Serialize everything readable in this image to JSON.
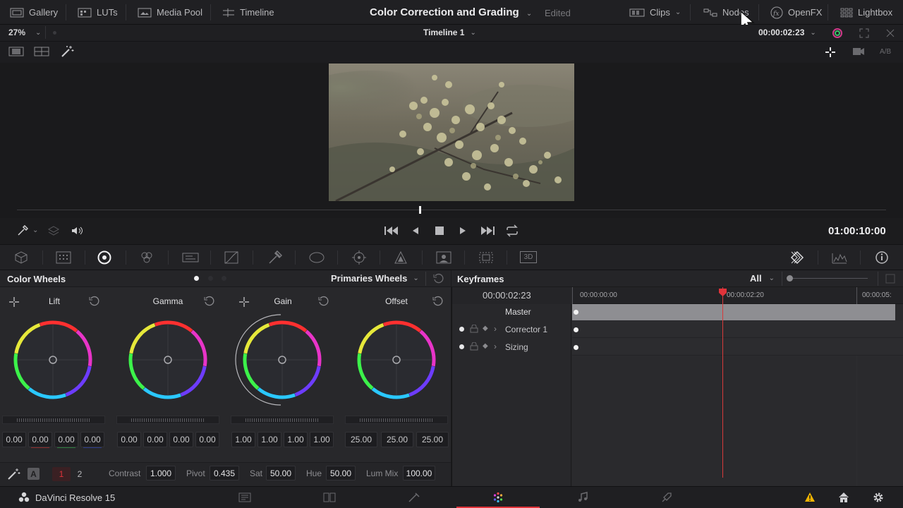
{
  "topnav": {
    "gallery": "Gallery",
    "luts": "LUTs",
    "media_pool": "Media Pool",
    "timeline": "Timeline",
    "page_title": "Color Correction and Grading",
    "edited": "Edited",
    "clips": "Clips",
    "nodes": "Nodes",
    "openfx": "OpenFX",
    "lightbox": "Lightbox"
  },
  "viewerbar": {
    "zoom": "27%",
    "timeline_name": "Timeline 1",
    "timecode": "00:00:02:23",
    "ab_label": "A/B"
  },
  "transport": {
    "timecode": "01:00:10:00"
  },
  "tools_row": {
    "threed_label": "3D"
  },
  "color_wheels": {
    "title": "Color Wheels",
    "mode": "Primaries Wheels",
    "wheels": [
      {
        "label": "Lift",
        "values": [
          "0.00",
          "0.00",
          "0.00",
          "0.00"
        ]
      },
      {
        "label": "Gamma",
        "values": [
          "0.00",
          "0.00",
          "0.00",
          "0.00"
        ]
      },
      {
        "label": "Gain",
        "values": [
          "1.00",
          "1.00",
          "1.00",
          "1.00"
        ]
      },
      {
        "label": "Offset",
        "values": [
          "25.00",
          "25.00",
          "25.00"
        ]
      }
    ],
    "footer": {
      "page1": "1",
      "page2": "2",
      "contrast_label": "Contrast",
      "contrast": "1.000",
      "pivot_label": "Pivot",
      "pivot": "0.435",
      "sat_label": "Sat",
      "sat": "50.00",
      "hue_label": "Hue",
      "hue": "50.00",
      "lummix_label": "Lum Mix",
      "lummix": "100.00"
    }
  },
  "keyframes": {
    "title": "Keyframes",
    "filter": "All",
    "current_timecode": "00:00:02:23",
    "ruler": [
      "00:00:00:00",
      "00:00:02:20",
      "00:00:05:"
    ],
    "tracks": [
      {
        "label": "Master"
      },
      {
        "label": "Corrector 1"
      },
      {
        "label": "Sizing"
      }
    ]
  },
  "bottombar": {
    "app_name": "DaVinci Resolve 15"
  },
  "colors": {
    "accent_red": "#e0333a",
    "playhead": "#d83a3a",
    "warning": "#f0b400"
  }
}
